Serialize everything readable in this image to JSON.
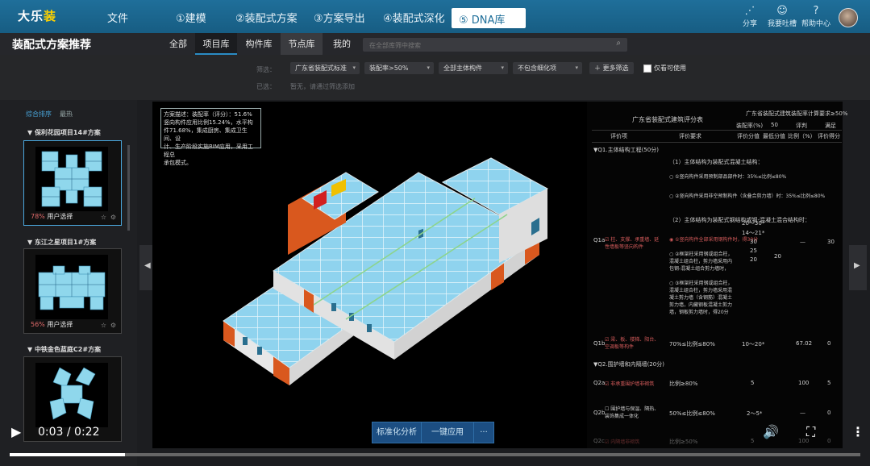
{
  "app": {
    "logo_main": "大乐",
    "logo_accent": "装",
    "menu": [
      "文件",
      "①建模",
      "②装配式方案",
      "③方案导出",
      "④装配式深化",
      "⑤ DNA库"
    ],
    "icons": [
      "分享",
      "我要吐槽",
      "帮助中心"
    ]
  },
  "subbar": {
    "title": "装配式方案推荐",
    "tabs": [
      "全部",
      "项目库",
      "构件库",
      "节点库",
      "我的"
    ],
    "search_placeholder": "在全部库筛中搜索"
  },
  "filter": {
    "label_filter": "筛选：",
    "label_selected": "已选：",
    "selects": [
      "广东省装配式标准",
      "装配率>50%",
      "全部主体构件",
      "不包含细化项"
    ],
    "more": "更多筛选",
    "only_usable": "仅看可使用",
    "selected_text": "暂无，请通过筛选添加"
  },
  "left": {
    "tabs": [
      "综合排序",
      "最热"
    ],
    "cards": [
      {
        "title": "保利花园项目14#方案",
        "pct": "78%",
        "users": "用户选择"
      },
      {
        "title": "东江之星项目1#方案",
        "pct": "56%",
        "users": "用户选择"
      },
      {
        "title": "中铁金色蓝庭C2#方案",
        "pct": "",
        "users": ""
      }
    ]
  },
  "viewer": {
    "desc_lines": [
      "方案描述：装配率（评分）：51.6%",
      "竖向构件应用比例15.24%，水平构",
      "件71.68%，集成厨房、集成卫生间、设",
      "计、生产阶段实施BIM应用，采用工程总",
      "承包模式。"
    ]
  },
  "table": {
    "title": "广东省装配式建筑评分表",
    "top_right": "广东省装配式建筑装配率计算要求≥50%",
    "rate_label": "装配率(%)",
    "rate_val": "50",
    "rate_col": "评判",
    "rate_result": "满足",
    "headers": [
      "评价项",
      "评价要求",
      "评价分值",
      "最低分值",
      "比例（%）",
      "评价得分"
    ],
    "sections": {
      "q1": "Q1.主体结构工程(50分)",
      "q2": "Q2.围护墙和内隔墙(20分)"
    },
    "q1a_label": "Q1a",
    "q1a_item": "柱、支撑、承重墙、延性墙板等竖向构件",
    "q1a_req": [
      "（1）主体结构为装配式混凝土结构：",
      "①竖向构件采用预制部品部件时：35%≤比例≤80%",
      "②竖向构件采用非空预制构件（含叠合剪力墙）时：35%≤比例≤80%",
      "（2）主体结构为装配式钢结构或钢-混凝土混合结构时：",
      "①竖向构件全部采用钢构件时，得30分",
      "②框架柱采用钢或组合柱，混凝土组合柱，剪力墙采用内包钢-混凝土组合剪力墙时，得25分",
      "③框架柱采用钢或组合柱，混凝土组合柱，剪力墙采用混凝土剪力墙（含钢筋）混凝土剪力墙，内藏钢板混凝土剪力墙，钢板剪力墙时，得20分"
    ],
    "q1a_scores": [
      "20～30*",
      "14～21*",
      "30",
      "25",
      "20"
    ],
    "q1a_min": "20",
    "q1a_ratio": "—",
    "q1a_get": "30",
    "q1b_label": "Q1b",
    "q1b_item": "梁、板、楼梯、阳台、空调板等构件",
    "q1b_req": "70%≤比例≤80%",
    "q1b_score": "10～20*",
    "q1b_ratio": "67.02",
    "q1b_get": "0",
    "q2a_label": "Q2a",
    "q2a_item": "非承重围护墙非砌筑",
    "q2a_req": "比例≥80%",
    "q2a_score": "5",
    "q2a_ratio": "100",
    "q2a_get": "5",
    "q2b_label": "Q2b",
    "q2b_item": "围护墙与保温、隔热、装饰集成一体化",
    "q2b_req": "50%≤比例≤80%",
    "q2b_score": "2～5*",
    "q2b_ratio": "—",
    "q2b_get": "0",
    "q2c_label": "Q2c",
    "q2c_item": "内隔墙非砌筑",
    "q2c_req": "比例≥50%",
    "q2c_score": "5",
    "q2c_ratio": "100",
    "q2c_get": "0"
  },
  "actions": {
    "analyze": "标准化分析",
    "apply": "一键应用",
    "more": "···"
  },
  "video": {
    "time": "0:03 / 0:22",
    "progress": 0.136
  },
  "colors": {
    "topbar": "#1f6f9a",
    "accent": "#2a8cc4",
    "red": "#d65c5c"
  }
}
